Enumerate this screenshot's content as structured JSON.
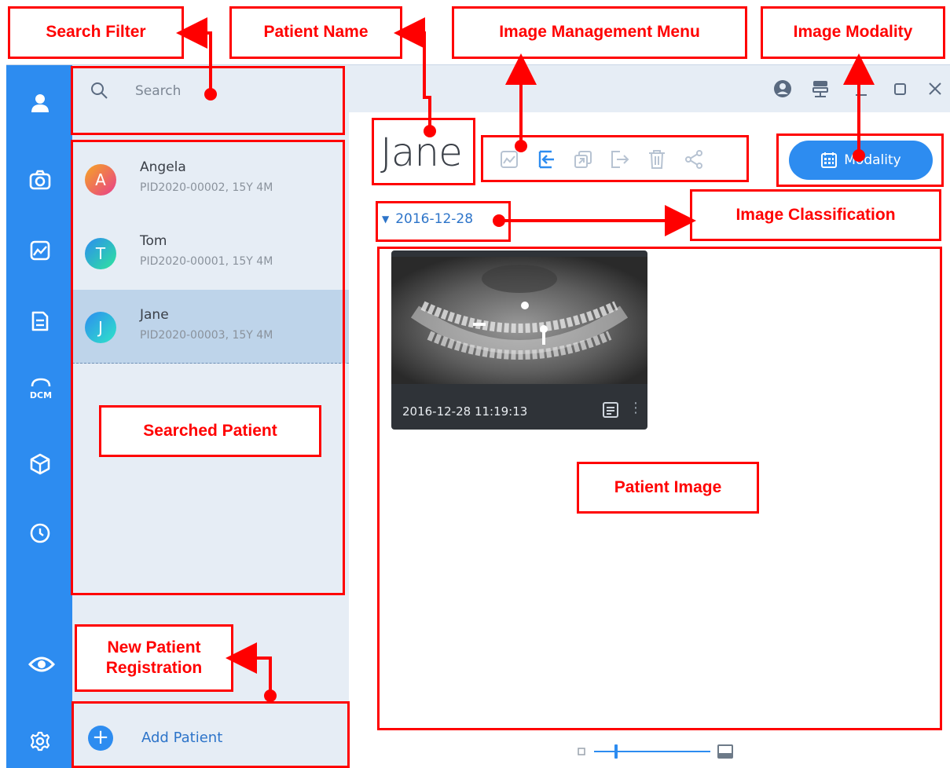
{
  "colors": {
    "accent": "#2d8cf0",
    "panel": "#e6edf5",
    "selected_row": "#bed4ea",
    "annotation": "#ff0000"
  },
  "rail": {
    "items": [
      {
        "icon": "person-icon"
      },
      {
        "icon": "camera-icon"
      },
      {
        "icon": "image-icon"
      },
      {
        "icon": "report-icon"
      },
      {
        "icon": "dcm-icon",
        "label": "DCM"
      },
      {
        "icon": "cube-icon"
      },
      {
        "icon": "clock-icon"
      },
      {
        "icon": "eye-icon"
      },
      {
        "icon": "gear-icon"
      }
    ]
  },
  "search": {
    "placeholder": "Search"
  },
  "patients": [
    {
      "initial": "A",
      "name": "Angela",
      "details": "PID2020-00002, 15Y 4M",
      "selected": false
    },
    {
      "initial": "T",
      "name": "Tom",
      "details": "PID2020-00001, 15Y 4M",
      "selected": false
    },
    {
      "initial": "J",
      "name": "Jane",
      "details": "PID2020-00003, 15Y 4M",
      "selected": true
    }
  ],
  "add_patient": {
    "label": "Add Patient"
  },
  "titlebar": {
    "icons": [
      "user-circle-icon",
      "network-icon",
      "minimize-icon",
      "maximize-icon",
      "close-icon"
    ]
  },
  "main": {
    "patient_name": "Jane",
    "toolbar_icons": [
      "image-view-icon",
      "import-icon",
      "copy-icon",
      "export-icon",
      "trash-icon",
      "share-icon"
    ],
    "modality_label": "Modality",
    "date_group": "2016-12-28",
    "thumbnail": {
      "timestamp": "2016-12-28  11:19:13",
      "icon": "note-icon"
    }
  },
  "annotations": {
    "search_filter": "Search Filter",
    "patient_name": "Patient Name",
    "image_management_menu": "Image Management Menu",
    "image_modality": "Image Modality",
    "image_classification": "Image Classification",
    "searched_patient": "Searched Patient",
    "patient_image": "Patient Image",
    "new_patient_registration": "New Patient Registration"
  }
}
